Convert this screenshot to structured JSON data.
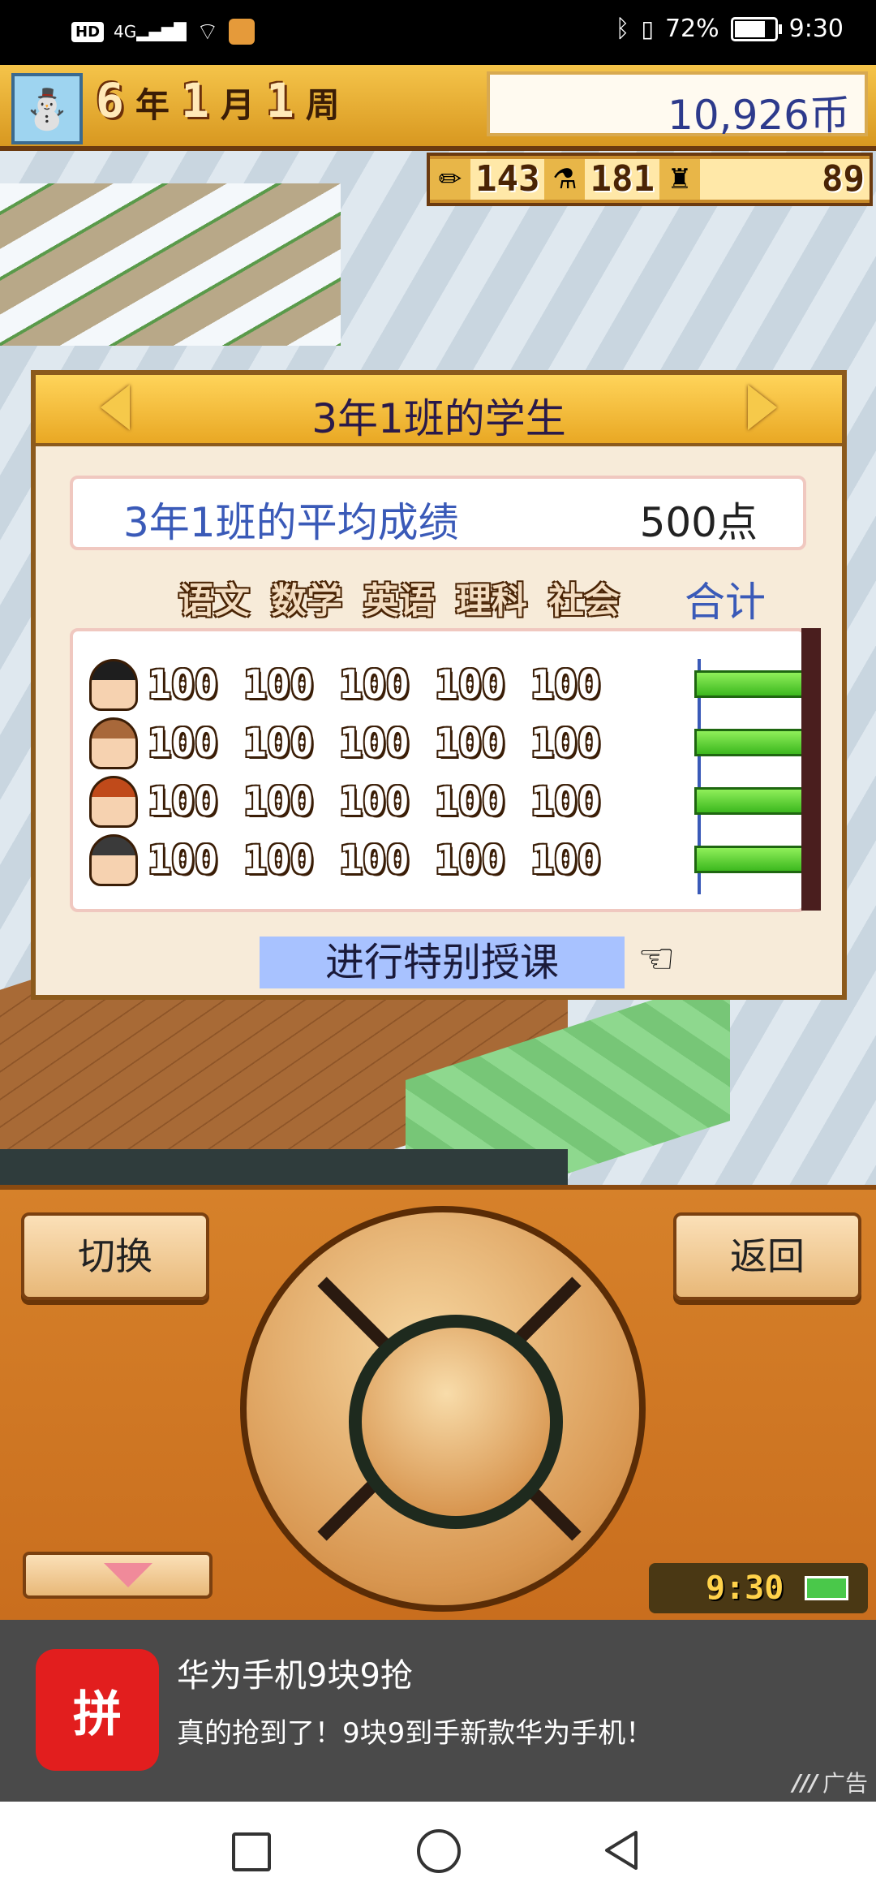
{
  "status_bar": {
    "network_badge": "HD",
    "signal": "4G",
    "battery_percent": "72%",
    "time": "9:30"
  },
  "game_bar": {
    "year": "6",
    "year_unit": "年",
    "month": "1",
    "month_unit": "月",
    "week": "1",
    "week_unit": "周",
    "money": "10,926币"
  },
  "resources": [
    {
      "icon": "pencil-icon",
      "value": "143"
    },
    {
      "icon": "flask-icon",
      "value": "181"
    },
    {
      "icon": "trophy-icon",
      "value": "89"
    }
  ],
  "dialog": {
    "title": "3年1班的学生",
    "avg_label": "3年1班的平均成绩",
    "avg_value": "500点",
    "subjects": [
      "语文",
      "数学",
      "英语",
      "理科",
      "社会"
    ],
    "total_label": "合计",
    "students": [
      {
        "scores": [
          "100",
          "100",
          "100",
          "100",
          "100"
        ],
        "total_fraction": 1.0,
        "avatar": "boy-black-hair"
      },
      {
        "scores": [
          "100",
          "100",
          "100",
          "100",
          "100"
        ],
        "total_fraction": 1.0,
        "avatar": "girl-brown-hair"
      },
      {
        "scores": [
          "100",
          "100",
          "100",
          "100",
          "100"
        ],
        "total_fraction": 1.0,
        "avatar": "girl-red-hair"
      },
      {
        "scores": [
          "100",
          "100",
          "100",
          "100",
          "100"
        ],
        "total_fraction": 1.0,
        "avatar": "boy-cap"
      }
    ],
    "special_lesson_label": "进行特别授课"
  },
  "controller": {
    "switch_label": "切换",
    "back_label": "返回",
    "clock": "9:30"
  },
  "ad": {
    "title": "华为手机9块9抢",
    "description": "真的抢到了！9块9到手新款华为手机！",
    "tag": "广告",
    "logo_text": "拼"
  },
  "colors": {
    "accent_blue": "#3a5ab8",
    "bar_green": "#3cb81e",
    "dialog_border": "#8c5a1c",
    "controller_orange": "#d6812a",
    "ad_red": "#e21e1e"
  }
}
